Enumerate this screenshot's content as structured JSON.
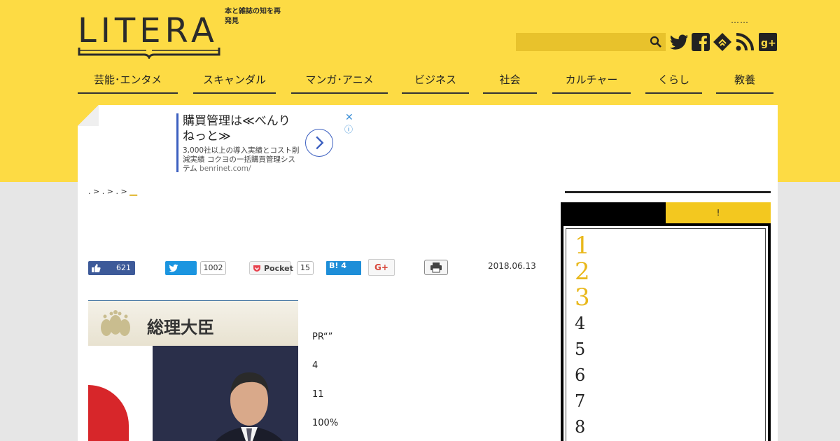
{
  "brand": {
    "logo_text": "LITERA",
    "tagline": "本と雑誌の知を再発見",
    "dots": "……"
  },
  "header": {
    "search_placeholder": "",
    "social_icons": [
      "twitter-icon",
      "facebook-icon",
      "feedly-icon",
      "rss-icon",
      "google-plus-icon"
    ]
  },
  "nav": {
    "items": [
      "芸能･エンタメ",
      "スキャンダル",
      "マンガ･アニメ",
      "ビジネス",
      "社会",
      "カルチャー",
      "くらし",
      "教養"
    ]
  },
  "ad": {
    "title": "購買管理は≪べんりねっと≫",
    "desc": "3,000社以上の導入実績とコスト削減実績 コクヨの一括購買管理システム",
    "domain": "benrinet.com/"
  },
  "breadcrumb": {
    "parts": [
      ".",
      ">",
      ".",
      ">",
      ".",
      ">"
    ],
    "current": "__"
  },
  "share": {
    "facebook_count": "621",
    "twitter_count": "1002",
    "pocket_label": "Pocket",
    "pocket_count": "15",
    "hatena_label": "B! 4",
    "gplus_label": "G+"
  },
  "article": {
    "date": "2018.06.13",
    "photo_caption": "総理大臣",
    "paragraphs": [
      "PR“”",
      "4",
      "11",
      "100%"
    ]
  },
  "sidebar": {
    "tab_left": "",
    "tab_right": "!",
    "ranks": [
      "1",
      "2",
      "3",
      "4",
      "5",
      "6",
      "7",
      "8"
    ]
  },
  "colors": {
    "brand_yellow": "#fddb44",
    "accent_gold": "#e9b81c",
    "facebook": "#3d5a99",
    "twitter": "#1b95e0",
    "hatena": "#1e8ed8"
  }
}
